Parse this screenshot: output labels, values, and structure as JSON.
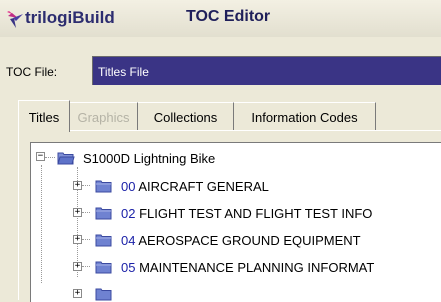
{
  "window": {
    "brand": "trilogiBuild",
    "title": "TOC Editor",
    "colors": {
      "accent": "#3a3485",
      "folder": "#5e73c9"
    }
  },
  "toc": {
    "label": "TOC File:",
    "value": "Titles File"
  },
  "tabs": [
    {
      "label": "Titles",
      "state": "active"
    },
    {
      "label": "Graphics",
      "state": "disabled"
    },
    {
      "label": "Collections",
      "state": "normal"
    },
    {
      "label": "Information Codes",
      "state": "normal"
    }
  ],
  "tree": {
    "root": {
      "label": "S1000D Lightning Bike",
      "expanded": true
    },
    "children": [
      {
        "code": "00",
        "label": "AIRCRAFT GENERAL"
      },
      {
        "code": "02",
        "label": "FLIGHT TEST AND FLIGHT TEST INFO"
      },
      {
        "code": "04",
        "label": "AEROSPACE GROUND EQUIPMENT"
      },
      {
        "code": "05",
        "label": "MAINTENANCE PLANNING INFORMAT"
      }
    ]
  }
}
